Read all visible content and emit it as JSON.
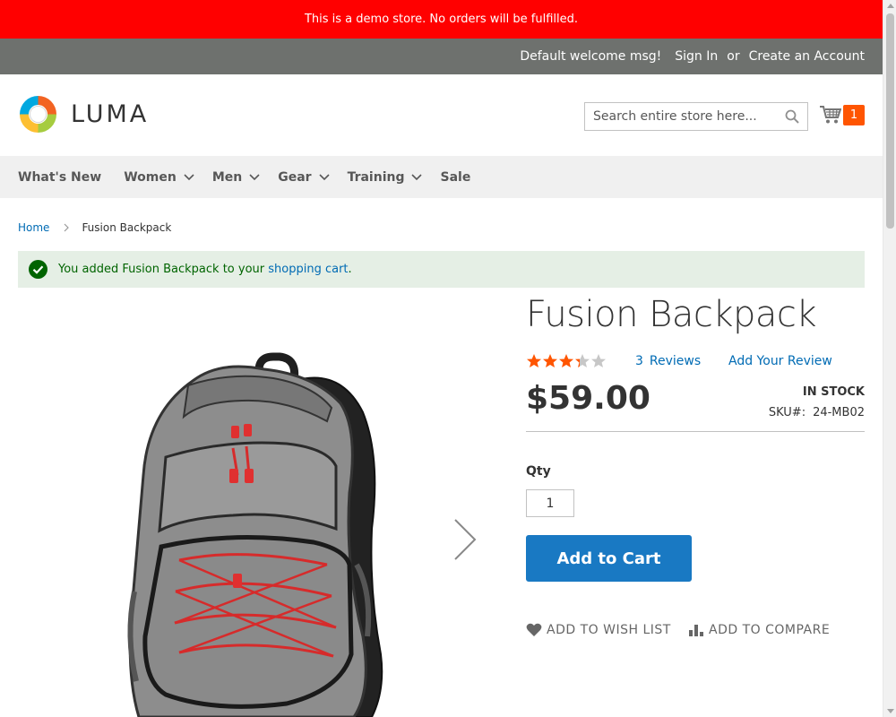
{
  "banner": {
    "text": "This is a demo store. No orders will be fulfilled."
  },
  "header": {
    "welcome": "Default welcome msg!",
    "sign_in": "Sign In",
    "or": "or",
    "create_account": "Create an Account"
  },
  "logo": {
    "text": "LUMA",
    "icon": "luma-logo-icon"
  },
  "search": {
    "placeholder": "Search entire store here...",
    "icon": "search-icon"
  },
  "cart": {
    "icon": "shopping-cart-icon",
    "count": "1",
    "badge_color": "#ff5501"
  },
  "nav": {
    "items": [
      {
        "label": "What's New",
        "has_submenu": false
      },
      {
        "label": "Women",
        "has_submenu": true
      },
      {
        "label": "Men",
        "has_submenu": true
      },
      {
        "label": "Gear",
        "has_submenu": true
      },
      {
        "label": "Training",
        "has_submenu": true
      },
      {
        "label": "Sale",
        "has_submenu": false
      }
    ]
  },
  "breadcrumb": {
    "home": "Home",
    "current": "Fusion Backpack"
  },
  "message": {
    "prefix": "You added Fusion Backpack to your ",
    "link": "shopping cart",
    "suffix": ".",
    "icon": "success-check-icon"
  },
  "product": {
    "title": "Fusion Backpack",
    "rating": 3,
    "rating_max": 5,
    "reviews_count": "3",
    "reviews_label": "Reviews",
    "add_review": "Add Your Review",
    "price": "$59.00",
    "stock": "IN STOCK",
    "sku_label": "SKU#:",
    "sku": "24-MB02",
    "qty_label": "Qty",
    "qty_value": "1",
    "add_to_cart": "Add to Cart",
    "wishlist": "ADD TO WISH LIST",
    "compare": "ADD TO COMPARE"
  },
  "colors": {
    "banner": "#ff0000",
    "header_panel": "#6e716e",
    "primary_button": "#1979c3",
    "link": "#006bb4",
    "success_bg": "#e5efe5",
    "star_filled": "#ff5501"
  }
}
